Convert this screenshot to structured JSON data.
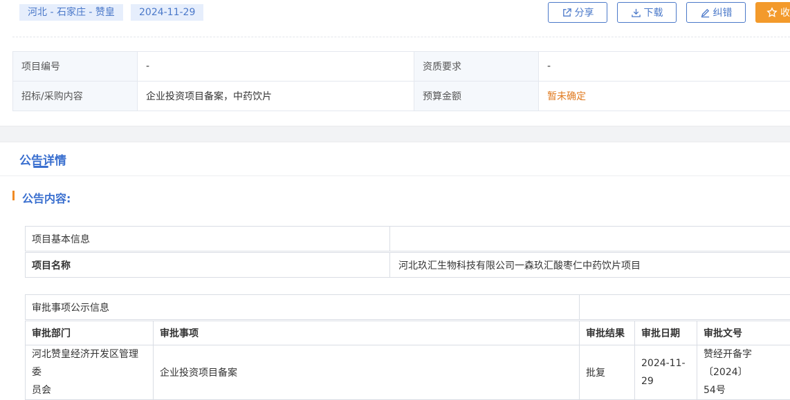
{
  "header": {
    "region_tag": "河北 - 石家庄 - 赞皇",
    "date_tag": "2024-11-29",
    "share_label": "分享",
    "download_label": "下载",
    "correct_label": "纠错",
    "collect_label": "收"
  },
  "info_table": {
    "row1": {
      "label1": "项目编号",
      "value1": "-",
      "label2": "资质要求",
      "value2": "-"
    },
    "row2": {
      "label1": "招标/采购内容",
      "value1": "企业投资项目备案，中药饮片",
      "label2": "预算金额",
      "value2": "暂未确定"
    }
  },
  "tab": {
    "title": "公告详情"
  },
  "section": {
    "title": "公告内容:"
  },
  "basic_info": {
    "header": "项目基本信息",
    "name_label": "项目名称",
    "name_value": "河北玖汇生物科技有限公司一森玖汇酸枣仁中药饮片项目"
  },
  "approval": {
    "header": "审批事项公示信息",
    "columns": [
      "审批部门",
      "审批事项",
      "审批结果",
      "审批日期",
      "审批文号"
    ],
    "row": {
      "dept_line1": "河北赞皇经济开发区管理委",
      "dept_line2": "员会",
      "item": "企业投资项目备案",
      "result": "批复",
      "date_line1": "2024-11-",
      "date_line2": "29",
      "doc_line1": "赞经开备字〔2024〕",
      "doc_line2": "54号"
    }
  },
  "colors": {
    "accent": "#3a6fcf",
    "orange": "#f39a2b",
    "tag_bg": "#e6eefc"
  }
}
